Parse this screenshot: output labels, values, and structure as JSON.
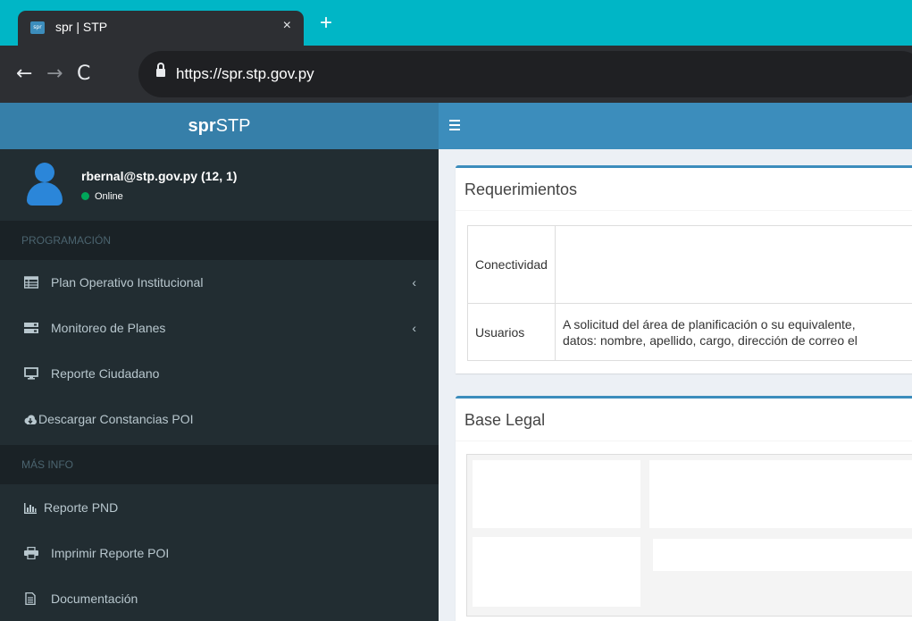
{
  "browser": {
    "tab_title": "spr | STP",
    "favicon_text": "spr",
    "close_glyph": "×",
    "newtab_glyph": "+",
    "back_glyph": "←",
    "forward_glyph": "→",
    "reload_glyph": "C",
    "url": "https://spr.stp.gov.py"
  },
  "header": {
    "logo_bold": "spr",
    "logo_rest": "STP"
  },
  "user": {
    "name": "rbernal@stp.gov.py (12, 1)",
    "status": "Online"
  },
  "sidebar": {
    "section_programacion": "PROGRAMACIÓN",
    "section_mas_info": "MÁS INFO",
    "chevron": "‹",
    "items": [
      {
        "label": "Plan Operativo Institucional",
        "icon": "table-icon"
      },
      {
        "label": "Monitoreo de Planes",
        "icon": "server-icon"
      },
      {
        "label": "Reporte Ciudadano",
        "icon": "desktop-icon"
      },
      {
        "label": "Descargar Constancias POI",
        "icon": "cloud-download-icon"
      },
      {
        "label": "Reporte PND",
        "icon": "bar-chart-icon"
      },
      {
        "label": "Imprimir Reporte POI",
        "icon": "print-icon"
      },
      {
        "label": "Documentación",
        "icon": "file-text-icon"
      }
    ]
  },
  "requerimientos": {
    "title": "Requerimientos",
    "rows": [
      {
        "col1": "Conectividad",
        "col2": ""
      },
      {
        "col1": "Usuarios",
        "col2_line1": "A solicitud del área de planificación o su equivalente,",
        "col2_line2": "datos: nombre, apellido, cargo, dirección de correo el"
      }
    ]
  },
  "base_legal": {
    "title": "Base Legal"
  },
  "colors": {
    "tabstrip": "#00b6c6",
    "chrome": "#2d2f33",
    "header_primary": "#3c8dbc",
    "logo_bg": "#367fa9",
    "sidebar_bg": "#222d32",
    "online": "#00a65a"
  }
}
